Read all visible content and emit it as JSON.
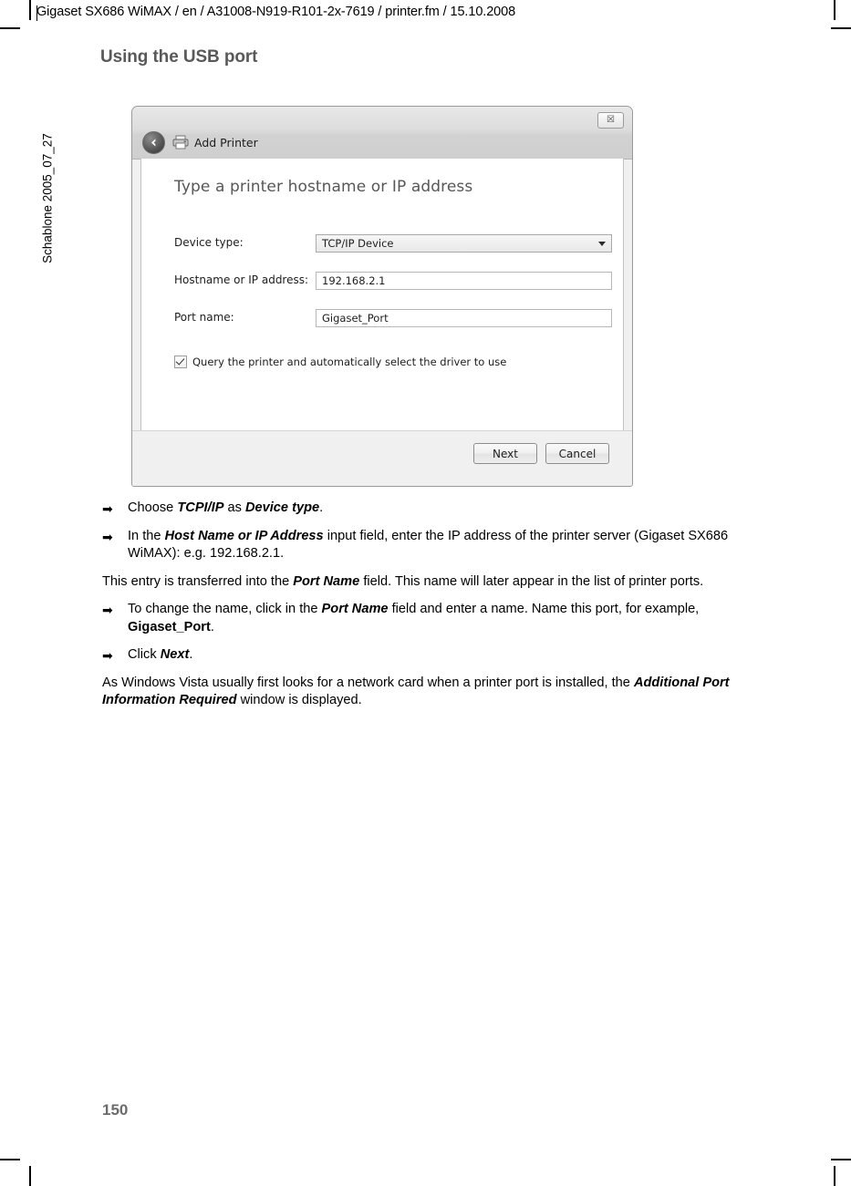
{
  "header": {
    "text": "Gigaset SX686 WiMAX / en / A31008-N919-R101-2x-7619 / printer.fm / 15.10.2008"
  },
  "side_label": "Schablone 2005_07_27",
  "headline": "Using the USB port",
  "page_number": "150",
  "dialog": {
    "title": "Add Printer",
    "close_glyph": "☒",
    "heading": "Type a printer hostname or IP address",
    "fields": [
      {
        "label": "Device type:",
        "value": "TCP/IP Device",
        "type": "combobox"
      },
      {
        "label": "Hostname or IP address:",
        "value": "192.168.2.1",
        "type": "text"
      },
      {
        "label": "Port name:",
        "value": "Gigaset_Port",
        "type": "text"
      }
    ],
    "checkbox": {
      "label": "Query the printer and automatically select the driver to use",
      "checked": true
    },
    "buttons": {
      "next": "Next",
      "cancel": "Cancel"
    }
  },
  "content": {
    "bullet_glyph": "➡",
    "step1": {
      "pre": "Choose ",
      "em1": "TCPI/IP",
      "mid": " as ",
      "em2": "Device type",
      "post": "."
    },
    "step2": {
      "pre": "In the ",
      "em1": "Host Name or IP Address",
      "post": " input field, enter the IP address of the printer server (Gigaset SX686 WiMAX): e.g. 192.168.2.1."
    },
    "note1": {
      "pre": "This entry is transferred into the ",
      "em1": "Port Name",
      "post": " field. This name will later appear in the list of printer ports."
    },
    "step3": {
      "pre": "To change the name, click in the ",
      "em1": "Port Name",
      "mid": " field and enter a name. Name this port, for example, ",
      "em2": "Gigaset_Port",
      "post": "."
    },
    "step4": {
      "pre": "Click ",
      "em1": "Next",
      "post": "."
    },
    "note2": {
      "pre": "As Windows Vista usually first looks for a network card when a printer port is installed, the ",
      "em1": "Additional Port Information Required",
      "post": " window is displayed."
    }
  }
}
